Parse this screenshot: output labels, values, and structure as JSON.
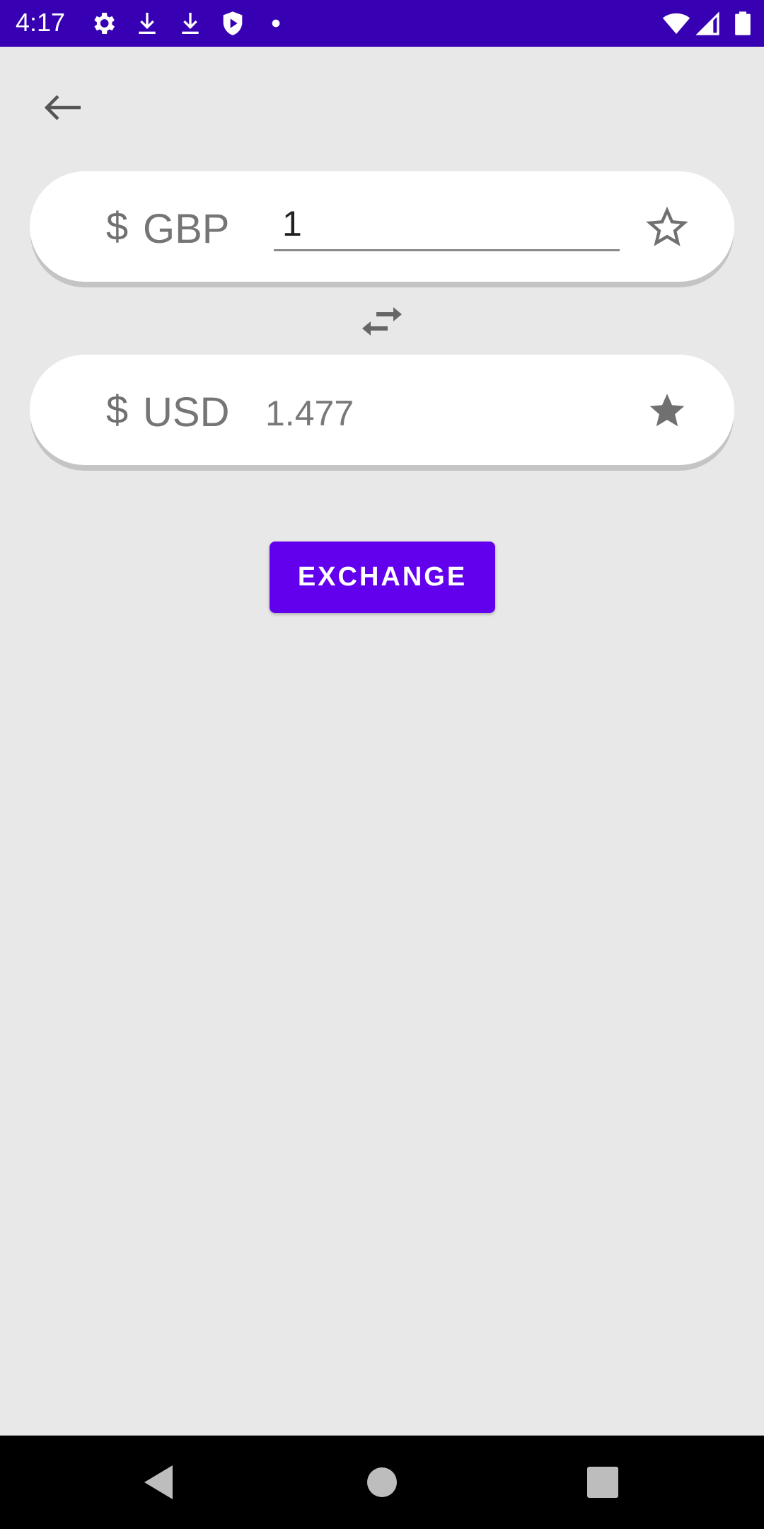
{
  "status_bar": {
    "time": "4:17",
    "background": "#3700b3",
    "left_icons": [
      "gear-icon",
      "download-icon",
      "download-icon",
      "shield-play-icon",
      "dot-icon"
    ],
    "right_icons": [
      "wifi-icon",
      "cell-signal-icon",
      "battery-icon"
    ]
  },
  "from": {
    "symbol": "$",
    "currency": "GBP",
    "amount": "1",
    "favorite": false
  },
  "to": {
    "symbol": "$",
    "currency": "USD",
    "amount": "1.477",
    "favorite": true
  },
  "actions": {
    "exchange_label": "EXCHANGE",
    "accent": "#6200ee"
  },
  "nav_bar": {
    "buttons": [
      "back-triangle-icon",
      "home-circle-icon",
      "recents-square-icon"
    ]
  }
}
